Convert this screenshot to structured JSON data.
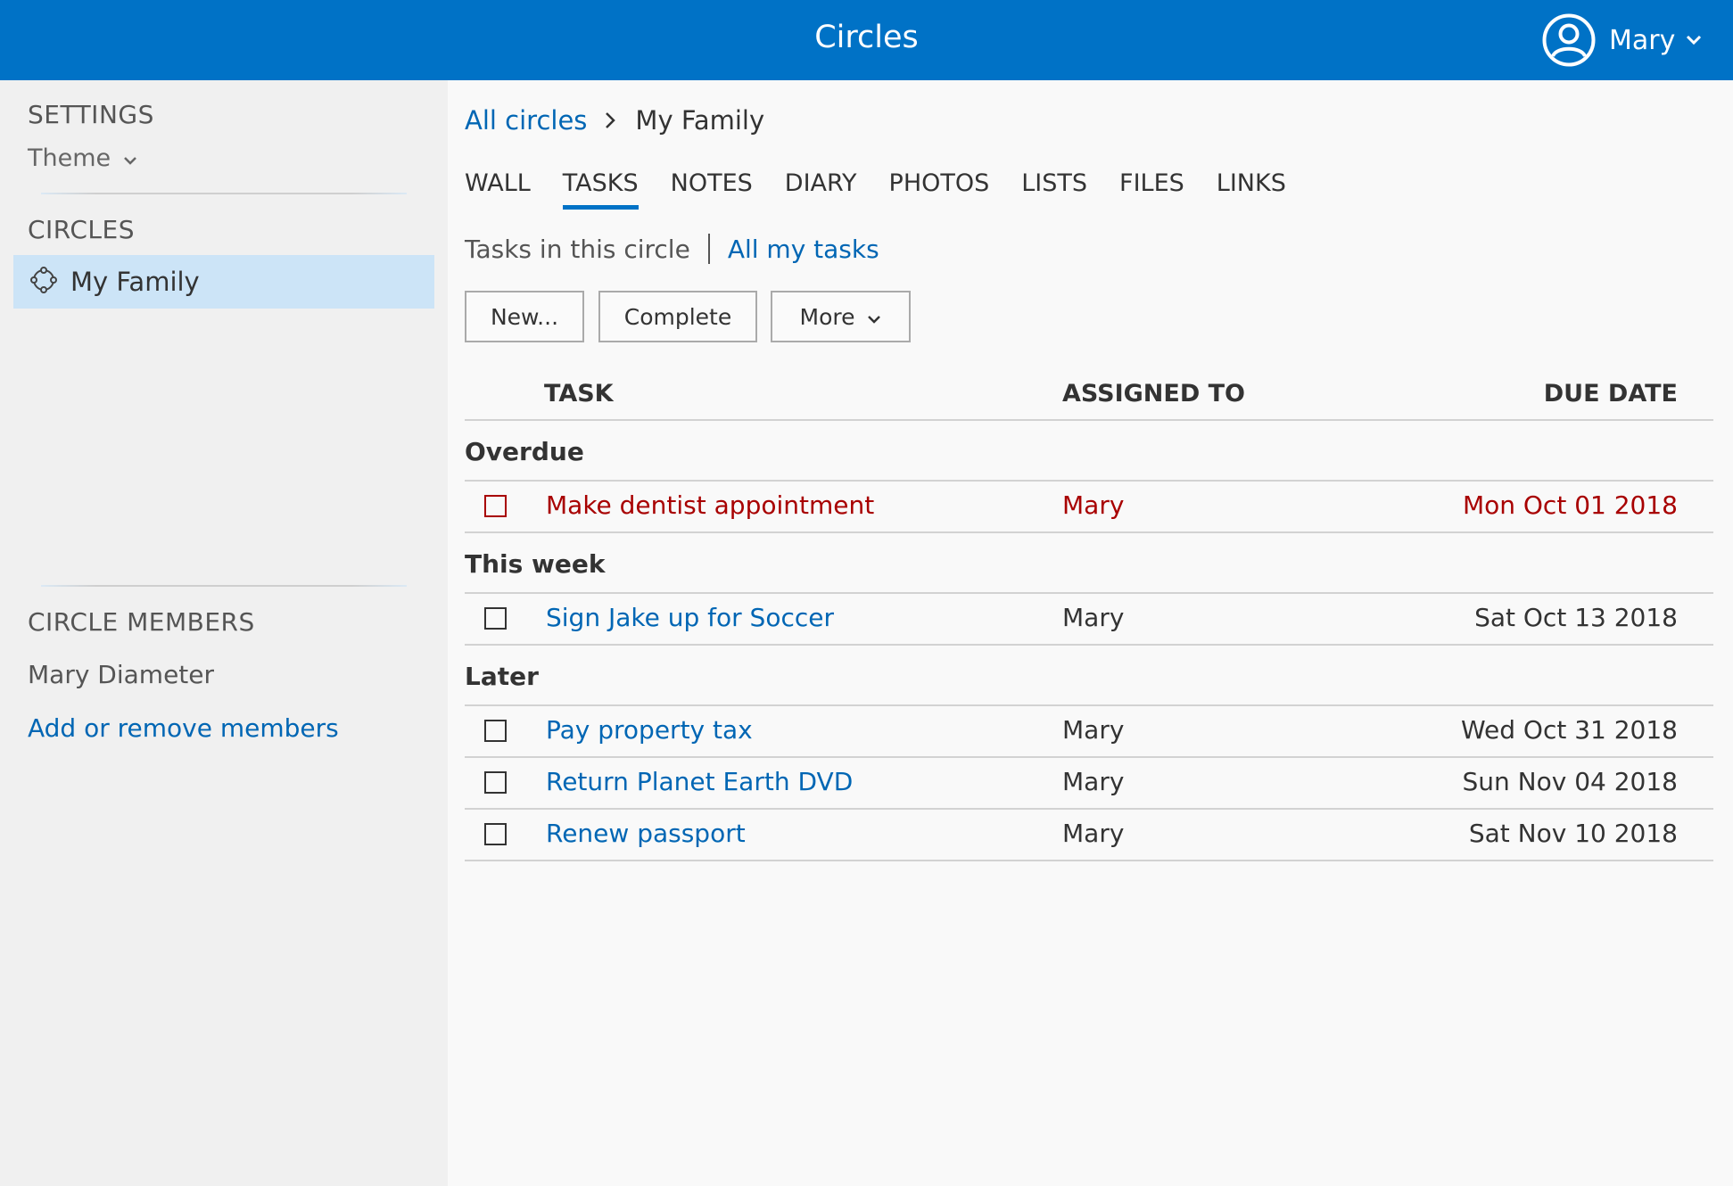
{
  "header": {
    "app_title": "Circles",
    "user_name": "Mary"
  },
  "sidebar": {
    "settings_heading": "SETTINGS",
    "theme_label": "Theme",
    "circles_heading": "CIRCLES",
    "circles": [
      {
        "label": "My Family",
        "selected": true
      }
    ],
    "members_heading": "CIRCLE MEMBERS",
    "members": [
      "Mary Diameter"
    ],
    "add_members_label": "Add or remove members"
  },
  "breadcrumb": {
    "root": "All circles",
    "current": "My Family"
  },
  "tabs": [
    {
      "label": "WALL",
      "active": false
    },
    {
      "label": "TASKS",
      "active": true
    },
    {
      "label": "NOTES",
      "active": false
    },
    {
      "label": "DIARY",
      "active": false
    },
    {
      "label": "PHOTOS",
      "active": false
    },
    {
      "label": "LISTS",
      "active": false
    },
    {
      "label": "FILES",
      "active": false
    },
    {
      "label": "LINKS",
      "active": false
    }
  ],
  "scope": {
    "current": "Tasks in this circle",
    "other": "All my tasks"
  },
  "toolbar": {
    "new_label": "New...",
    "complete_label": "Complete",
    "more_label": "More"
  },
  "table": {
    "columns": {
      "task": "TASK",
      "assigned": "ASSIGNED TO",
      "due": "DUE DATE"
    },
    "groups": [
      {
        "title": "Overdue",
        "rows": [
          {
            "task": "Make dentist appointment",
            "assigned": "Mary",
            "due": "Mon Oct 01 2018",
            "overdue": true
          }
        ]
      },
      {
        "title": "This week",
        "rows": [
          {
            "task": "Sign Jake up for Soccer",
            "assigned": "Mary",
            "due": "Sat Oct 13 2018"
          }
        ]
      },
      {
        "title": "Later",
        "rows": [
          {
            "task": "Pay property tax",
            "assigned": "Mary",
            "due": "Wed Oct 31 2018"
          },
          {
            "task": "Return Planet Earth DVD",
            "assigned": "Mary",
            "due": "Sun Nov 04 2018"
          },
          {
            "task": "Renew passport",
            "assigned": "Mary",
            "due": "Sat Nov 10 2018"
          }
        ]
      }
    ]
  },
  "colors": {
    "brand": "#0072c6",
    "link": "#0066b4",
    "overdue": "#a80000",
    "selected_bg": "#cce4f7"
  },
  "icons": {
    "user": "user-circle-icon",
    "circle": "circle-nodes-icon",
    "chevron": "chevron-down-icon",
    "separator": "chevron-right-icon"
  }
}
